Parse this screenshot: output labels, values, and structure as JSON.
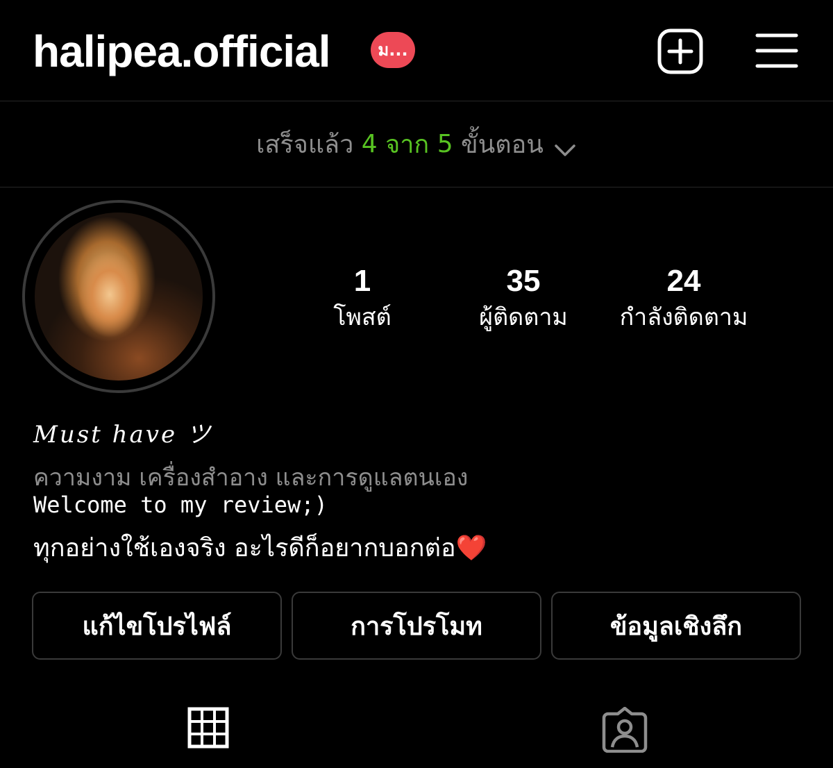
{
  "header": {
    "username": "halipea.official",
    "badge_text": "ม...",
    "badge_color": "#ed4956",
    "new_post_icon": "plus-square-icon",
    "menu_icon": "hamburger-menu-icon"
  },
  "setup_progress": {
    "prefix": "เสร็จแล้ว",
    "completed": "4",
    "of_word": "จาก",
    "total": "5",
    "suffix": "ขั้นตอน",
    "accent_color": "#58c322"
  },
  "stats": {
    "posts": {
      "value": "1",
      "label": "โพสต์"
    },
    "followers": {
      "value": "35",
      "label": "ผู้ติดตาม"
    },
    "following": {
      "value": "24",
      "label": "กำลังติดตาม"
    }
  },
  "bio": {
    "title": "Must have ツ",
    "category": "ความงาม เครื่องสำอาง และการดูแลตนเอง",
    "line1": "Welcome to my review;)",
    "line2": "ทุกอย่างใช้เองจริง อะไรดีก็อยากบอกต่อ",
    "heart": "❤️"
  },
  "buttons": {
    "edit_profile": "แก้ไขโปรไฟล์",
    "promotions": "การโปรโมท",
    "insights": "ข้อมูลเชิงลึก"
  },
  "tabs": {
    "grid_icon": "grid-icon",
    "tagged_icon": "tagged-person-icon"
  }
}
